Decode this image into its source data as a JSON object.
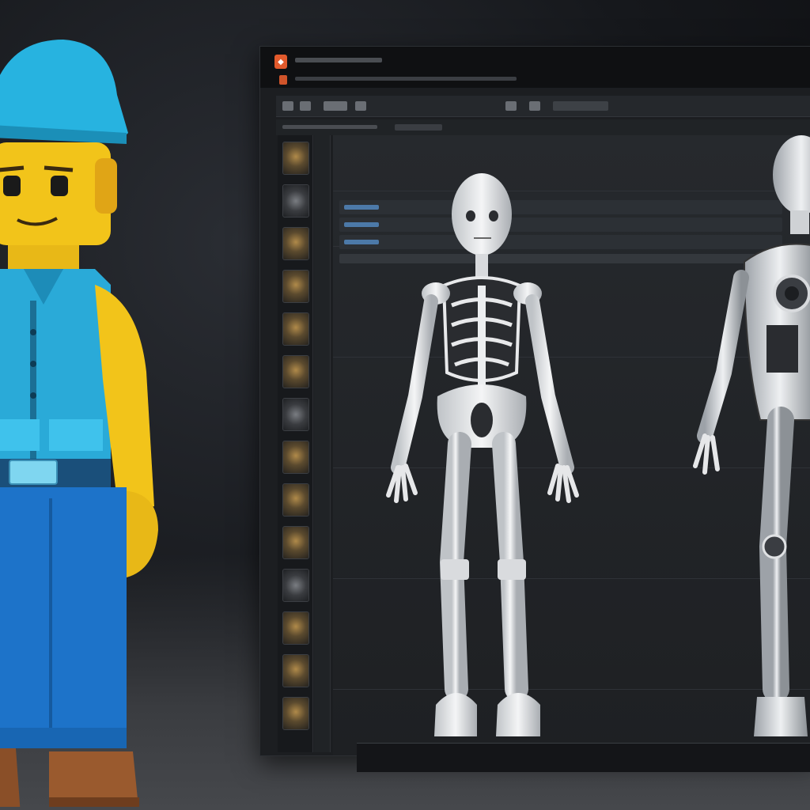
{
  "app": {
    "logo_glyph": "◆"
  },
  "colors": {
    "accent": "#e25a2c",
    "panel": "#1c1e21",
    "selection": "#4c79a8",
    "lego_shirt": "#2aaad8",
    "lego_skin": "#f2c41a",
    "lego_pants": "#1d73c9"
  },
  "icons": {
    "app_logo": "app-logo-icon",
    "thumbnails": "asset-thumbnail-icon"
  },
  "thumbnails": [
    {
      "kind": "skull"
    },
    {
      "kind": "ring"
    },
    {
      "kind": "bust"
    },
    {
      "kind": "bust"
    },
    {
      "kind": "bust"
    },
    {
      "kind": "bust"
    },
    {
      "kind": "ring"
    },
    {
      "kind": "bust"
    },
    {
      "kind": "bust"
    },
    {
      "kind": "bust"
    },
    {
      "kind": "ring"
    },
    {
      "kind": "bust"
    },
    {
      "kind": "bust"
    },
    {
      "kind": "bust"
    }
  ]
}
